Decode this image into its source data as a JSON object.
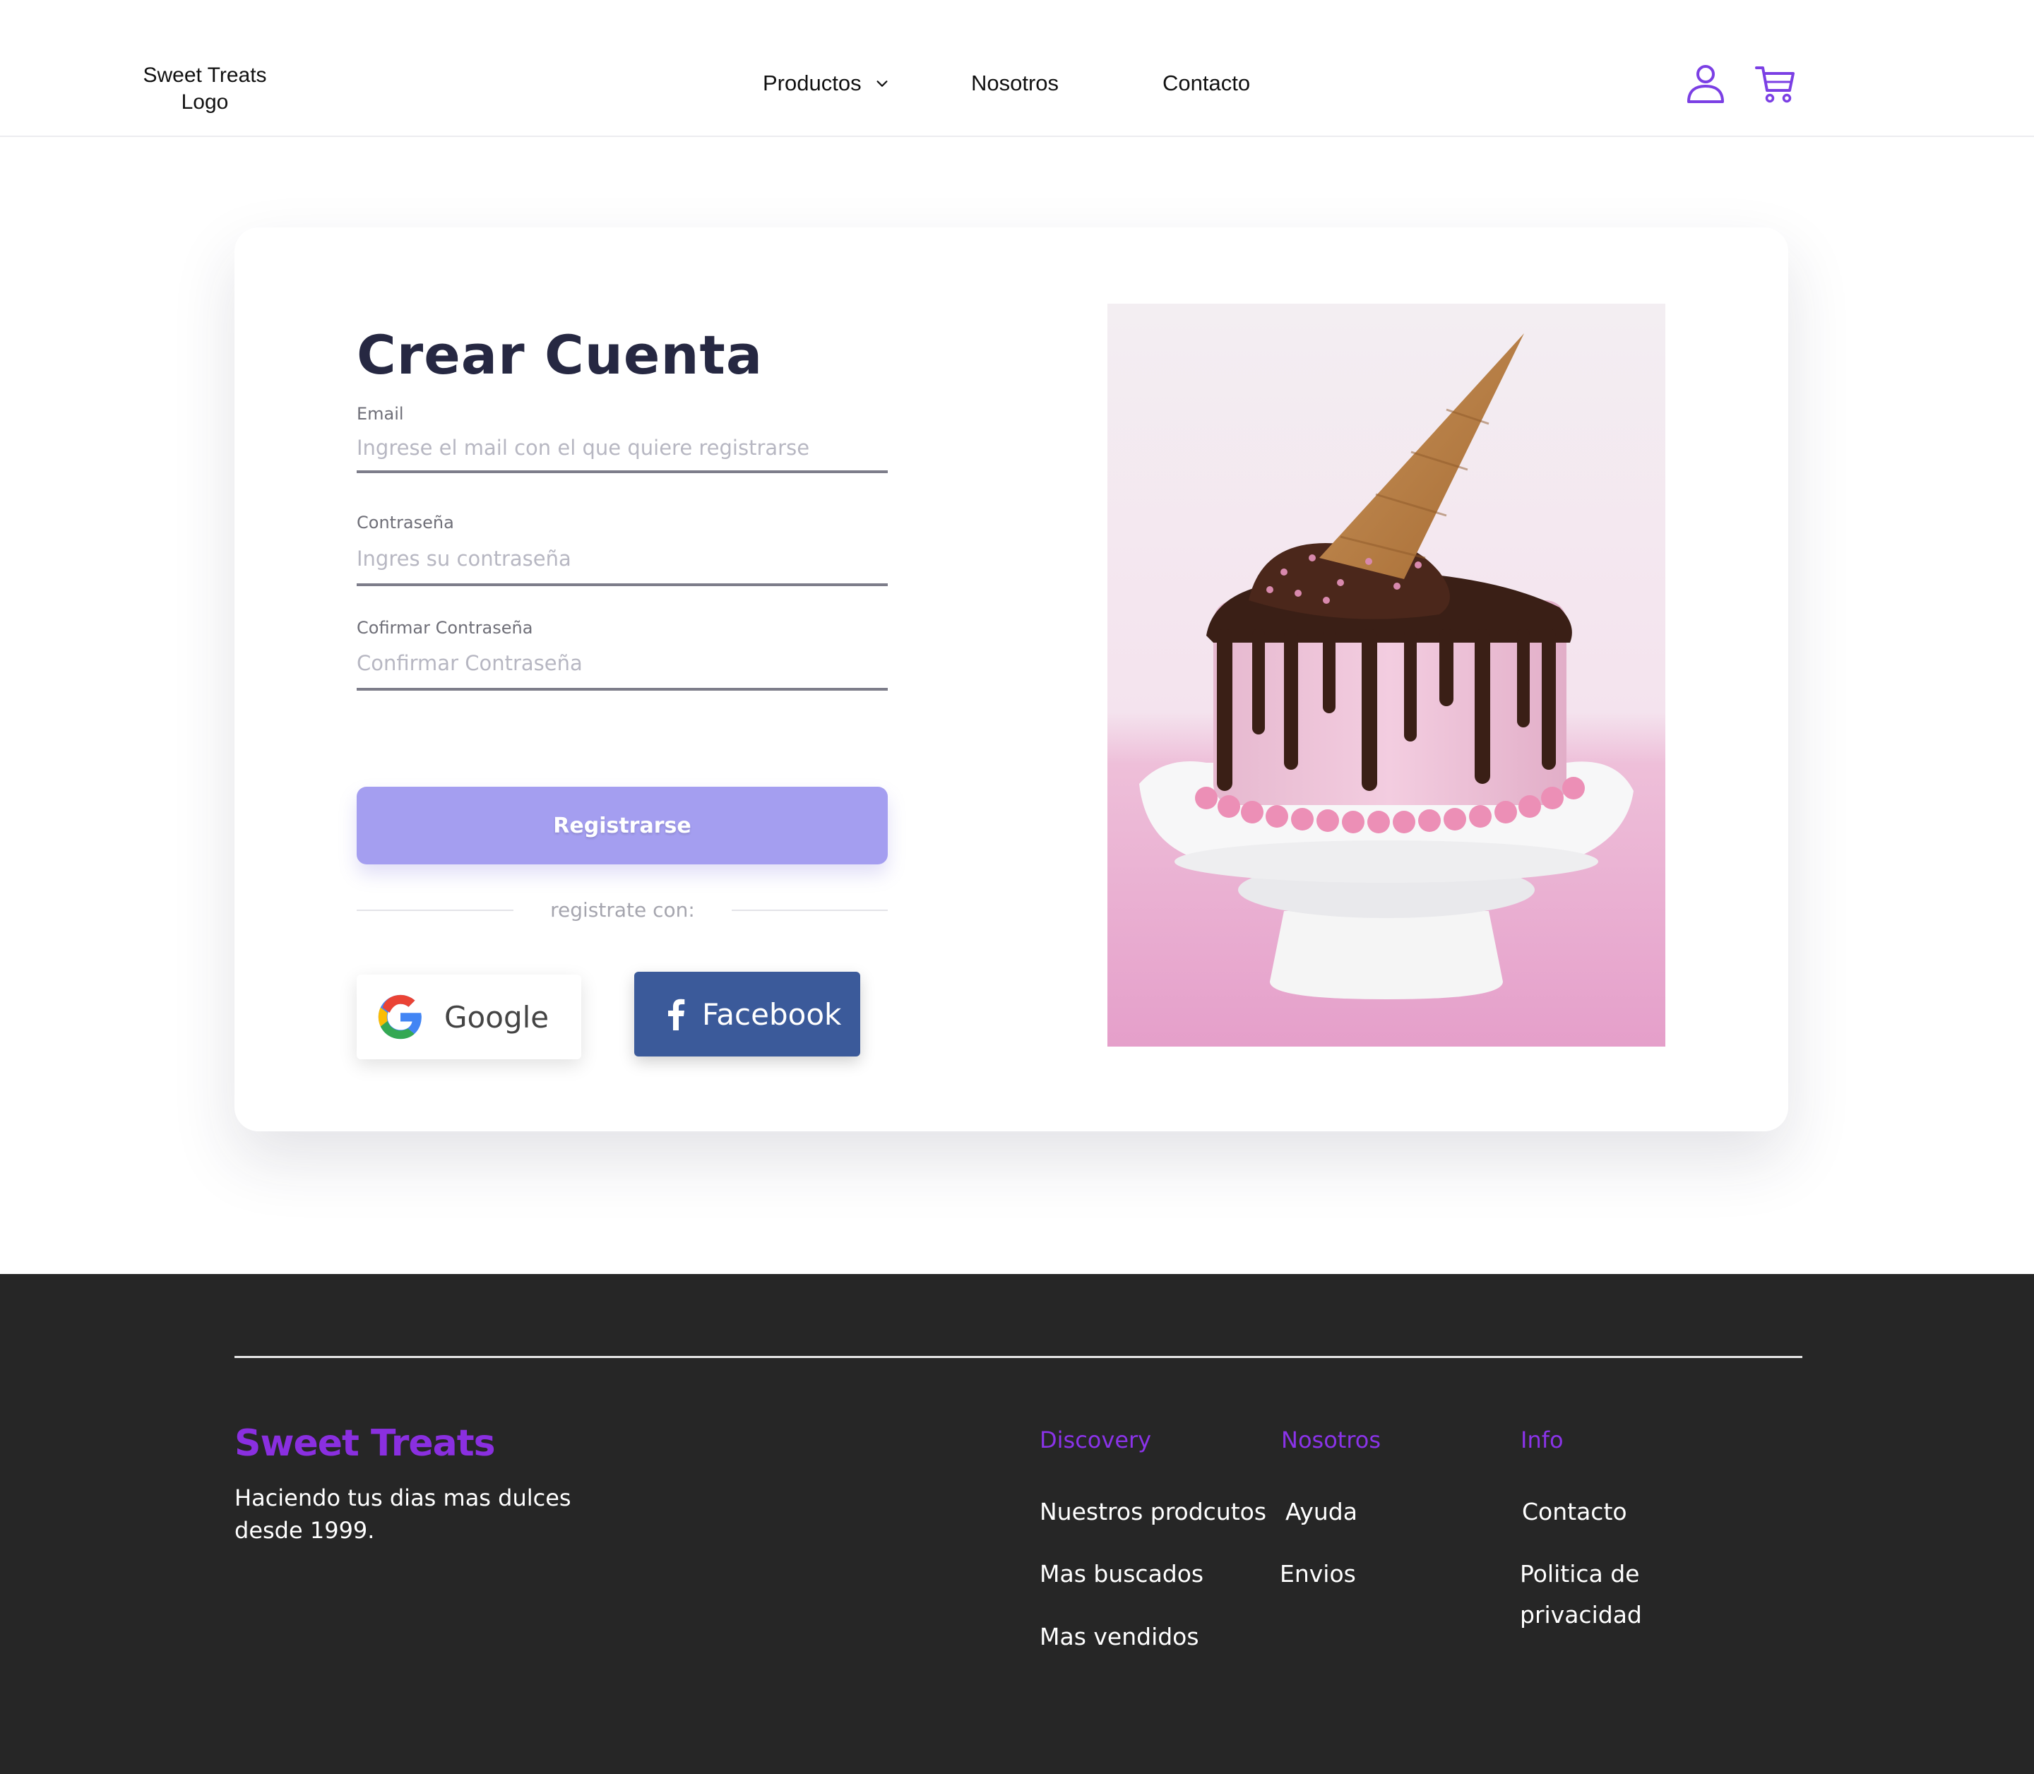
{
  "header": {
    "logo_line1": "Sweet Treats",
    "logo_line2": "Logo",
    "nav": {
      "productos": "Productos",
      "nosotros": "Nosotros",
      "contacto": "Contacto"
    },
    "icons": [
      "user-icon",
      "cart-icon"
    ],
    "accent_color": "#7b3fe4"
  },
  "form": {
    "title": "Crear Cuenta",
    "email_label": "Email",
    "email_placeholder": "Ingrese el mail con el que quiere registrarse",
    "password_label": "Contraseña",
    "password_placeholder": "Ingres su contraseña",
    "confirm_label": "Cofirmar  Contraseña",
    "confirm_placeholder": "Confirmar Contraseña",
    "submit_label": "Registrarse",
    "divider_text": "registrate con:",
    "google_label": "Google",
    "facebook_label": "Facebook",
    "button_color": "#a49ef0",
    "facebook_color": "#3b5a9a"
  },
  "image": {
    "subject": "pink cake with chocolate drip and ice cream cone"
  },
  "footer": {
    "brand": "Sweet Treats",
    "tagline": "Haciendo tus dias mas dulces desde 1999.",
    "columns": [
      {
        "title": "Discovery",
        "links": [
          "Nuestros prodcutos",
          "Mas buscados",
          "Mas  vendidos"
        ]
      },
      {
        "title": "Nosotros",
        "links": [
          "Ayuda",
          "Envios"
        ]
      },
      {
        "title": "Info",
        "links": [
          "Contacto",
          "Politica de privacidad"
        ]
      }
    ],
    "background": "#262626",
    "heading_color": "#8a33e8"
  }
}
